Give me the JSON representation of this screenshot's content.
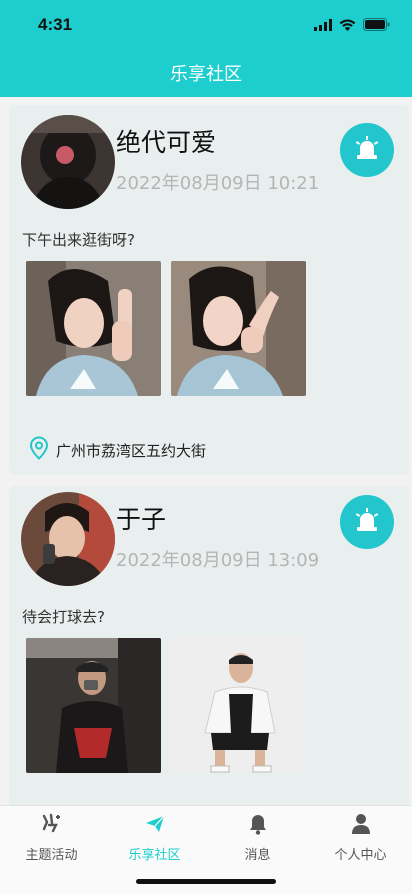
{
  "status_bar": {
    "time": "4:31"
  },
  "header": {
    "title": "乐享社区",
    "accent_color": "#1ecdcd"
  },
  "posts": [
    {
      "user": "绝代可爱",
      "time": "2022年08月09日  10:21",
      "text": "下午出来逛街呀?",
      "location": "广州市荔湾区五约大街",
      "alert_icon": "alarm-light-icon"
    },
    {
      "user": "于子",
      "time": "2022年08月09日  13:09",
      "text": "待会打球去?",
      "alert_icon": "alarm-light-icon"
    }
  ],
  "tabs": [
    {
      "label": "主题活动",
      "icon": "activity-icon"
    },
    {
      "label": "乐享社区",
      "icon": "paper-plane-icon",
      "active": true
    },
    {
      "label": "消息",
      "icon": "bell-icon"
    },
    {
      "label": "个人中心",
      "icon": "person-icon"
    }
  ]
}
